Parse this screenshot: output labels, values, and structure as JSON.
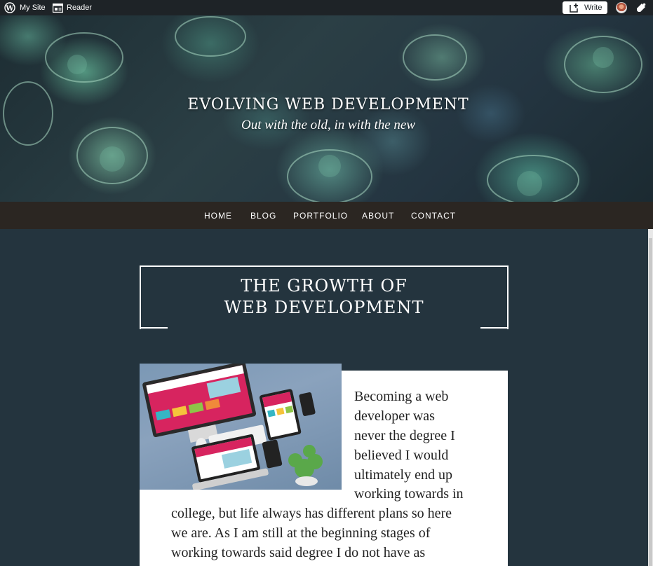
{
  "adminbar": {
    "my_site": "My Site",
    "reader": "Reader",
    "write": "Write",
    "icons": [
      "wordpress-logo-icon",
      "reader-icon",
      "write-icon",
      "avatar",
      "notifications-icon"
    ]
  },
  "site": {
    "title": "EVOLVING WEB DEVELOPMENT",
    "tagline": "Out with the old, in with the new"
  },
  "nav": {
    "items": [
      "HOME",
      "BLOG",
      "PORTFOLIO",
      "ABOUT",
      "CONTACT"
    ]
  },
  "post": {
    "title_line1": "THE GROWTH OF",
    "title_line2": "WEB DEVELOPMENT",
    "lines": [
      "Becoming a web",
      "developer was",
      "never the degree I",
      "believed I would",
      "ultimately end up",
      "working towards in",
      "college, but life always has different plans so here",
      "we are. As I am still at the beginning stages of",
      "working towards said degree I do not have as"
    ]
  },
  "colors": {
    "adminbar": "#1e2327",
    "nav": "#2b2622",
    "page_bg": "#24343e",
    "content_bg": "#ffffff"
  }
}
